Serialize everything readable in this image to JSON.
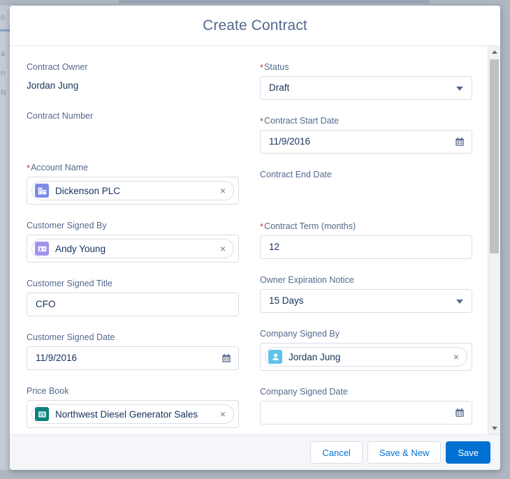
{
  "modal": {
    "title": "Create Contract"
  },
  "form": {
    "left": [
      {
        "type": "static",
        "name": "contract-owner",
        "label": "Contract Owner",
        "required": false,
        "value": "Jordan Jung"
      },
      {
        "type": "static",
        "name": "contract-number",
        "label": "Contract Number",
        "required": false,
        "value": ""
      },
      {
        "type": "lookup",
        "name": "account-name",
        "label": "Account Name",
        "required": true,
        "value": "Dickenson PLC",
        "icon": "account-icon",
        "icon_color": "#7c8ce5",
        "remove_label": "×"
      },
      {
        "type": "lookup",
        "name": "customer-signed-by",
        "label": "Customer Signed By",
        "required": false,
        "value": "Andy Young",
        "icon": "contact-icon",
        "icon_color": "#a094ed",
        "remove_label": "×"
      },
      {
        "type": "text",
        "name": "customer-signed-title",
        "label": "Customer Signed Title",
        "required": false,
        "value": "CFO"
      },
      {
        "type": "date",
        "name": "customer-signed-date",
        "label": "Customer Signed Date",
        "required": false,
        "value": "11/9/2016"
      },
      {
        "type": "lookup",
        "name": "price-book",
        "label": "Price Book",
        "required": false,
        "value": "Northwest Diesel Generator Sales",
        "icon": "pricebook-icon",
        "icon_color": "#0b827c",
        "remove_label": "×"
      }
    ],
    "right": [
      {
        "type": "select",
        "name": "status",
        "label": "Status",
        "required": true,
        "value": "Draft"
      },
      {
        "type": "date",
        "name": "contract-start-date",
        "label": "Contract Start Date",
        "required": true,
        "value": "11/9/2016"
      },
      {
        "type": "static",
        "name": "contract-end-date",
        "label": "Contract End Date",
        "required": false,
        "value": ""
      },
      {
        "type": "text",
        "name": "contract-term-months",
        "label": "Contract Term (months)",
        "required": true,
        "value": "12"
      },
      {
        "type": "select",
        "name": "owner-expiration-notice",
        "label": "Owner Expiration Notice",
        "required": false,
        "value": "15 Days"
      },
      {
        "type": "lookup",
        "name": "company-signed-by",
        "label": "Company Signed By",
        "required": false,
        "value": "Jordan Jung",
        "icon": "user-icon",
        "icon_color": "#5ec4e8",
        "remove_label": "×"
      },
      {
        "type": "date",
        "name": "company-signed-date",
        "label": "Company Signed Date",
        "required": false,
        "value": ""
      }
    ]
  },
  "footer": {
    "cancel_label": "Cancel",
    "save_new_label": "Save & New",
    "save_label": "Save"
  },
  "colors": {
    "brand_blue": "#0070d2",
    "label_slate": "#54698d",
    "value_navy": "#16325c",
    "required_red": "#c23934",
    "border": "#d8dde6",
    "footer_bg": "#f4f6f9",
    "backdrop": "#aeb7c2"
  },
  "backdrop": {
    "fragments": [
      "o",
      "a",
      "n",
      "N"
    ]
  }
}
